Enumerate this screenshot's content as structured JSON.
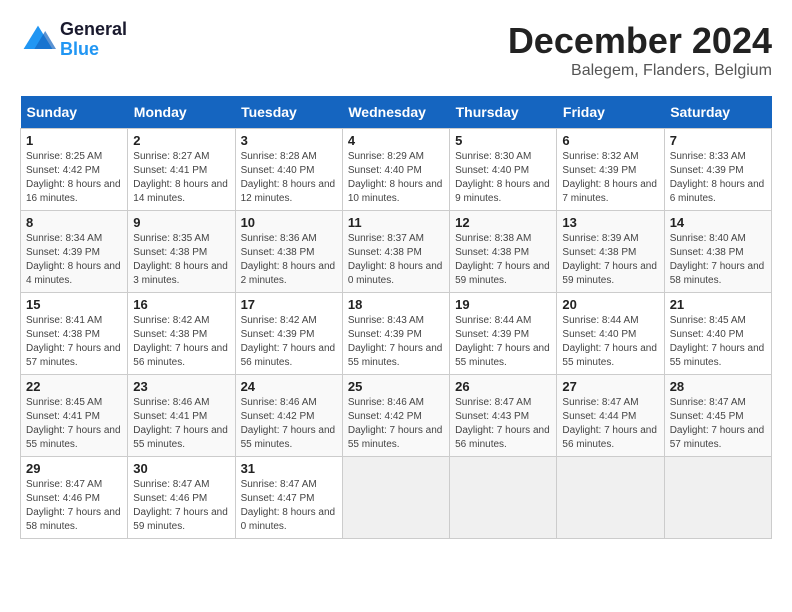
{
  "logo": {
    "line1": "General",
    "line2": "Blue"
  },
  "title": "December 2024",
  "location": "Balegem, Flanders, Belgium",
  "days_of_week": [
    "Sunday",
    "Monday",
    "Tuesday",
    "Wednesday",
    "Thursday",
    "Friday",
    "Saturday"
  ],
  "weeks": [
    [
      {
        "day": "1",
        "sunrise": "8:25 AM",
        "sunset": "4:42 PM",
        "daylight": "8 hours and 16 minutes."
      },
      {
        "day": "2",
        "sunrise": "8:27 AM",
        "sunset": "4:41 PM",
        "daylight": "8 hours and 14 minutes."
      },
      {
        "day": "3",
        "sunrise": "8:28 AM",
        "sunset": "4:40 PM",
        "daylight": "8 hours and 12 minutes."
      },
      {
        "day": "4",
        "sunrise": "8:29 AM",
        "sunset": "4:40 PM",
        "daylight": "8 hours and 10 minutes."
      },
      {
        "day": "5",
        "sunrise": "8:30 AM",
        "sunset": "4:40 PM",
        "daylight": "8 hours and 9 minutes."
      },
      {
        "day": "6",
        "sunrise": "8:32 AM",
        "sunset": "4:39 PM",
        "daylight": "8 hours and 7 minutes."
      },
      {
        "day": "7",
        "sunrise": "8:33 AM",
        "sunset": "4:39 PM",
        "daylight": "8 hours and 6 minutes."
      }
    ],
    [
      {
        "day": "8",
        "sunrise": "8:34 AM",
        "sunset": "4:39 PM",
        "daylight": "8 hours and 4 minutes."
      },
      {
        "day": "9",
        "sunrise": "8:35 AM",
        "sunset": "4:38 PM",
        "daylight": "8 hours and 3 minutes."
      },
      {
        "day": "10",
        "sunrise": "8:36 AM",
        "sunset": "4:38 PM",
        "daylight": "8 hours and 2 minutes."
      },
      {
        "day": "11",
        "sunrise": "8:37 AM",
        "sunset": "4:38 PM",
        "daylight": "8 hours and 0 minutes."
      },
      {
        "day": "12",
        "sunrise": "8:38 AM",
        "sunset": "4:38 PM",
        "daylight": "7 hours and 59 minutes."
      },
      {
        "day": "13",
        "sunrise": "8:39 AM",
        "sunset": "4:38 PM",
        "daylight": "7 hours and 59 minutes."
      },
      {
        "day": "14",
        "sunrise": "8:40 AM",
        "sunset": "4:38 PM",
        "daylight": "7 hours and 58 minutes."
      }
    ],
    [
      {
        "day": "15",
        "sunrise": "8:41 AM",
        "sunset": "4:38 PM",
        "daylight": "7 hours and 57 minutes."
      },
      {
        "day": "16",
        "sunrise": "8:42 AM",
        "sunset": "4:38 PM",
        "daylight": "7 hours and 56 minutes."
      },
      {
        "day": "17",
        "sunrise": "8:42 AM",
        "sunset": "4:39 PM",
        "daylight": "7 hours and 56 minutes."
      },
      {
        "day": "18",
        "sunrise": "8:43 AM",
        "sunset": "4:39 PM",
        "daylight": "7 hours and 55 minutes."
      },
      {
        "day": "19",
        "sunrise": "8:44 AM",
        "sunset": "4:39 PM",
        "daylight": "7 hours and 55 minutes."
      },
      {
        "day": "20",
        "sunrise": "8:44 AM",
        "sunset": "4:40 PM",
        "daylight": "7 hours and 55 minutes."
      },
      {
        "day": "21",
        "sunrise": "8:45 AM",
        "sunset": "4:40 PM",
        "daylight": "7 hours and 55 minutes."
      }
    ],
    [
      {
        "day": "22",
        "sunrise": "8:45 AM",
        "sunset": "4:41 PM",
        "daylight": "7 hours and 55 minutes."
      },
      {
        "day": "23",
        "sunrise": "8:46 AM",
        "sunset": "4:41 PM",
        "daylight": "7 hours and 55 minutes."
      },
      {
        "day": "24",
        "sunrise": "8:46 AM",
        "sunset": "4:42 PM",
        "daylight": "7 hours and 55 minutes."
      },
      {
        "day": "25",
        "sunrise": "8:46 AM",
        "sunset": "4:42 PM",
        "daylight": "7 hours and 55 minutes."
      },
      {
        "day": "26",
        "sunrise": "8:47 AM",
        "sunset": "4:43 PM",
        "daylight": "7 hours and 56 minutes."
      },
      {
        "day": "27",
        "sunrise": "8:47 AM",
        "sunset": "4:44 PM",
        "daylight": "7 hours and 56 minutes."
      },
      {
        "day": "28",
        "sunrise": "8:47 AM",
        "sunset": "4:45 PM",
        "daylight": "7 hours and 57 minutes."
      }
    ],
    [
      {
        "day": "29",
        "sunrise": "8:47 AM",
        "sunset": "4:46 PM",
        "daylight": "7 hours and 58 minutes."
      },
      {
        "day": "30",
        "sunrise": "8:47 AM",
        "sunset": "4:46 PM",
        "daylight": "7 hours and 59 minutes."
      },
      {
        "day": "31",
        "sunrise": "8:47 AM",
        "sunset": "4:47 PM",
        "daylight": "8 hours and 0 minutes."
      },
      null,
      null,
      null,
      null
    ]
  ]
}
